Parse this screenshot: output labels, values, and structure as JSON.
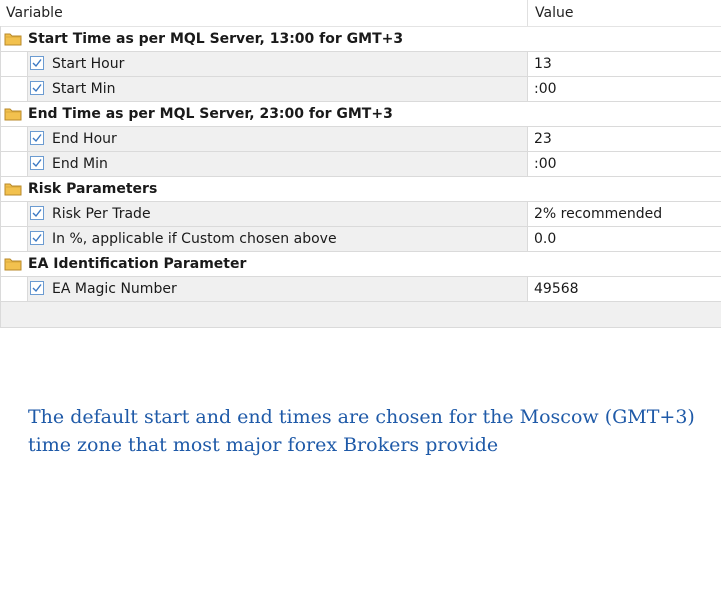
{
  "table": {
    "headers": {
      "variable": "Variable",
      "value": "Value"
    },
    "rows": [
      {
        "kind": "group",
        "label": "Start Time as per MQL Server, 13:00 for GMT+3"
      },
      {
        "kind": "param",
        "label": "Start Hour",
        "value": "13"
      },
      {
        "kind": "param",
        "label": "Start Min",
        "value": ":00"
      },
      {
        "kind": "group",
        "label": "End Time as per MQL Server, 23:00 for GMT+3"
      },
      {
        "kind": "param",
        "label": "End Hour",
        "value": "23"
      },
      {
        "kind": "param",
        "label": "End Min",
        "value": ":00"
      },
      {
        "kind": "group",
        "label": "Risk Parameters"
      },
      {
        "kind": "param",
        "label": "Risk Per Trade",
        "value": "2% recommended"
      },
      {
        "kind": "param",
        "label": "In %, applicable if Custom chosen above",
        "value": "0.0"
      },
      {
        "kind": "group",
        "label": "EA Identification Parameter"
      },
      {
        "kind": "param",
        "label": "EA Magic Number",
        "value": "49568"
      }
    ]
  },
  "note": {
    "line1": "The default start and end times are chosen for the Moscow (GMT+3)",
    "line2": "time zone that most major forex Brokers provide"
  },
  "icons": {
    "group": "folder-icon",
    "param": "checkbox-checked-icon"
  },
  "colors": {
    "note_text": "#1f5aa8",
    "folder": "#f2c14e",
    "check": "#3a78c3"
  }
}
